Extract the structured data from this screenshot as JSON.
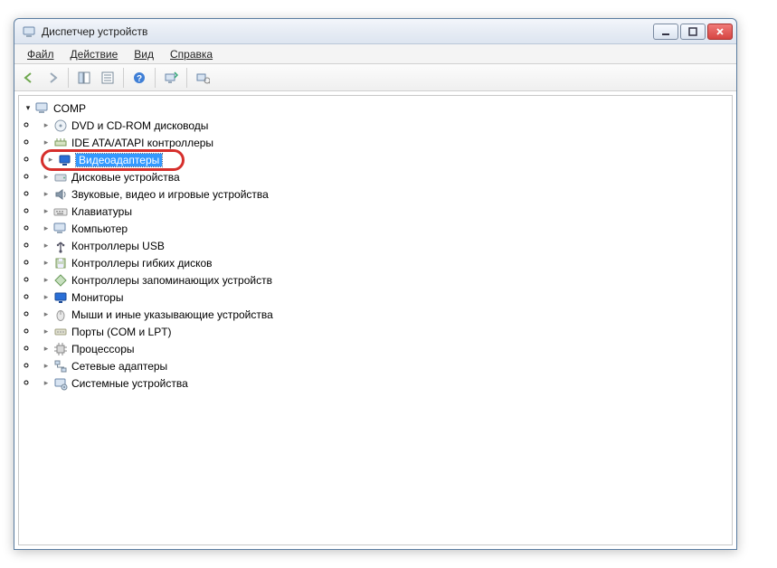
{
  "window": {
    "title": "Диспетчер устройств"
  },
  "menu": {
    "file": "Файл",
    "action": "Действие",
    "view": "Вид",
    "help": "Справка"
  },
  "tree": {
    "root": {
      "label": "COMP",
      "icon": "computer-icon"
    },
    "items": [
      {
        "label": "DVD и CD-ROM дисководы",
        "icon": "disc-icon",
        "highlighted": false
      },
      {
        "label": "IDE ATA/ATAPI контроллеры",
        "icon": "controller-icon",
        "highlighted": false
      },
      {
        "label": "Видеоадаптеры",
        "icon": "display-adapter-icon",
        "highlighted": true
      },
      {
        "label": "Дисковые устройства",
        "icon": "drive-icon",
        "highlighted": false
      },
      {
        "label": "Звуковые, видео и игровые устройства",
        "icon": "sound-icon",
        "highlighted": false
      },
      {
        "label": "Клавиатуры",
        "icon": "keyboard-icon",
        "highlighted": false
      },
      {
        "label": "Компьютер",
        "icon": "computer-icon",
        "highlighted": false
      },
      {
        "label": "Контроллеры USB",
        "icon": "usb-icon",
        "highlighted": false
      },
      {
        "label": "Контроллеры гибких дисков",
        "icon": "floppy-ctrl-icon",
        "highlighted": false
      },
      {
        "label": "Контроллеры запоминающих устройств",
        "icon": "storage-ctrl-icon",
        "highlighted": false
      },
      {
        "label": "Мониторы",
        "icon": "monitor-icon",
        "highlighted": false
      },
      {
        "label": "Мыши и иные указывающие устройства",
        "icon": "mouse-icon",
        "highlighted": false
      },
      {
        "label": "Порты (COM и LPT)",
        "icon": "port-icon",
        "highlighted": false
      },
      {
        "label": "Процессоры",
        "icon": "cpu-icon",
        "highlighted": false
      },
      {
        "label": "Сетевые адаптеры",
        "icon": "network-icon",
        "highlighted": false
      },
      {
        "label": "Системные устройства",
        "icon": "system-icon",
        "highlighted": false
      }
    ]
  },
  "icons": {
    "disc-icon": "💿",
    "controller-icon": "🔌",
    "display-adapter-icon": "🖥",
    "drive-icon": "🗄",
    "sound-icon": "🔊",
    "keyboard-icon": "⌨",
    "computer-icon": "💻",
    "usb-icon": "ψ",
    "floppy-ctrl-icon": "💾",
    "storage-ctrl-icon": "◇",
    "monitor-icon": "🖵",
    "mouse-icon": "🖱",
    "port-icon": "�printers",
    "cpu-icon": "▣",
    "network-icon": "🖧",
    "system-icon": "🖳"
  }
}
